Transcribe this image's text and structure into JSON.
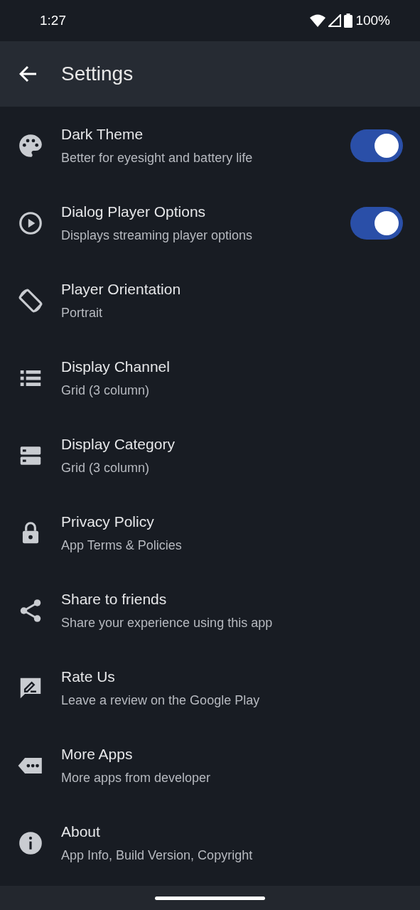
{
  "status_bar": {
    "time": "1:27",
    "battery": "100%"
  },
  "app_bar": {
    "title": "Settings"
  },
  "settings": [
    {
      "kind": "toggle",
      "title": "Dark Theme",
      "subtitle": "Better for eyesight and battery life",
      "on": true
    },
    {
      "kind": "toggle",
      "title": "Dialog Player Options",
      "subtitle": "Displays streaming player options",
      "on": true
    },
    {
      "kind": "plain",
      "title": "Player Orientation",
      "subtitle": "Portrait"
    },
    {
      "kind": "plain",
      "title": "Display Channel",
      "subtitle": "Grid (3 column)"
    },
    {
      "kind": "plain",
      "title": "Display Category",
      "subtitle": "Grid (3 column)"
    },
    {
      "kind": "plain",
      "title": "Privacy Policy",
      "subtitle": "App Terms & Policies"
    },
    {
      "kind": "plain",
      "title": "Share to friends",
      "subtitle": "Share your experience using this app"
    },
    {
      "kind": "plain",
      "title": "Rate Us",
      "subtitle": "Leave a review on the Google Play"
    },
    {
      "kind": "plain",
      "title": "More Apps",
      "subtitle": "More apps from developer"
    },
    {
      "kind": "plain",
      "title": "About",
      "subtitle": "App Info, Build Version, Copyright"
    }
  ]
}
